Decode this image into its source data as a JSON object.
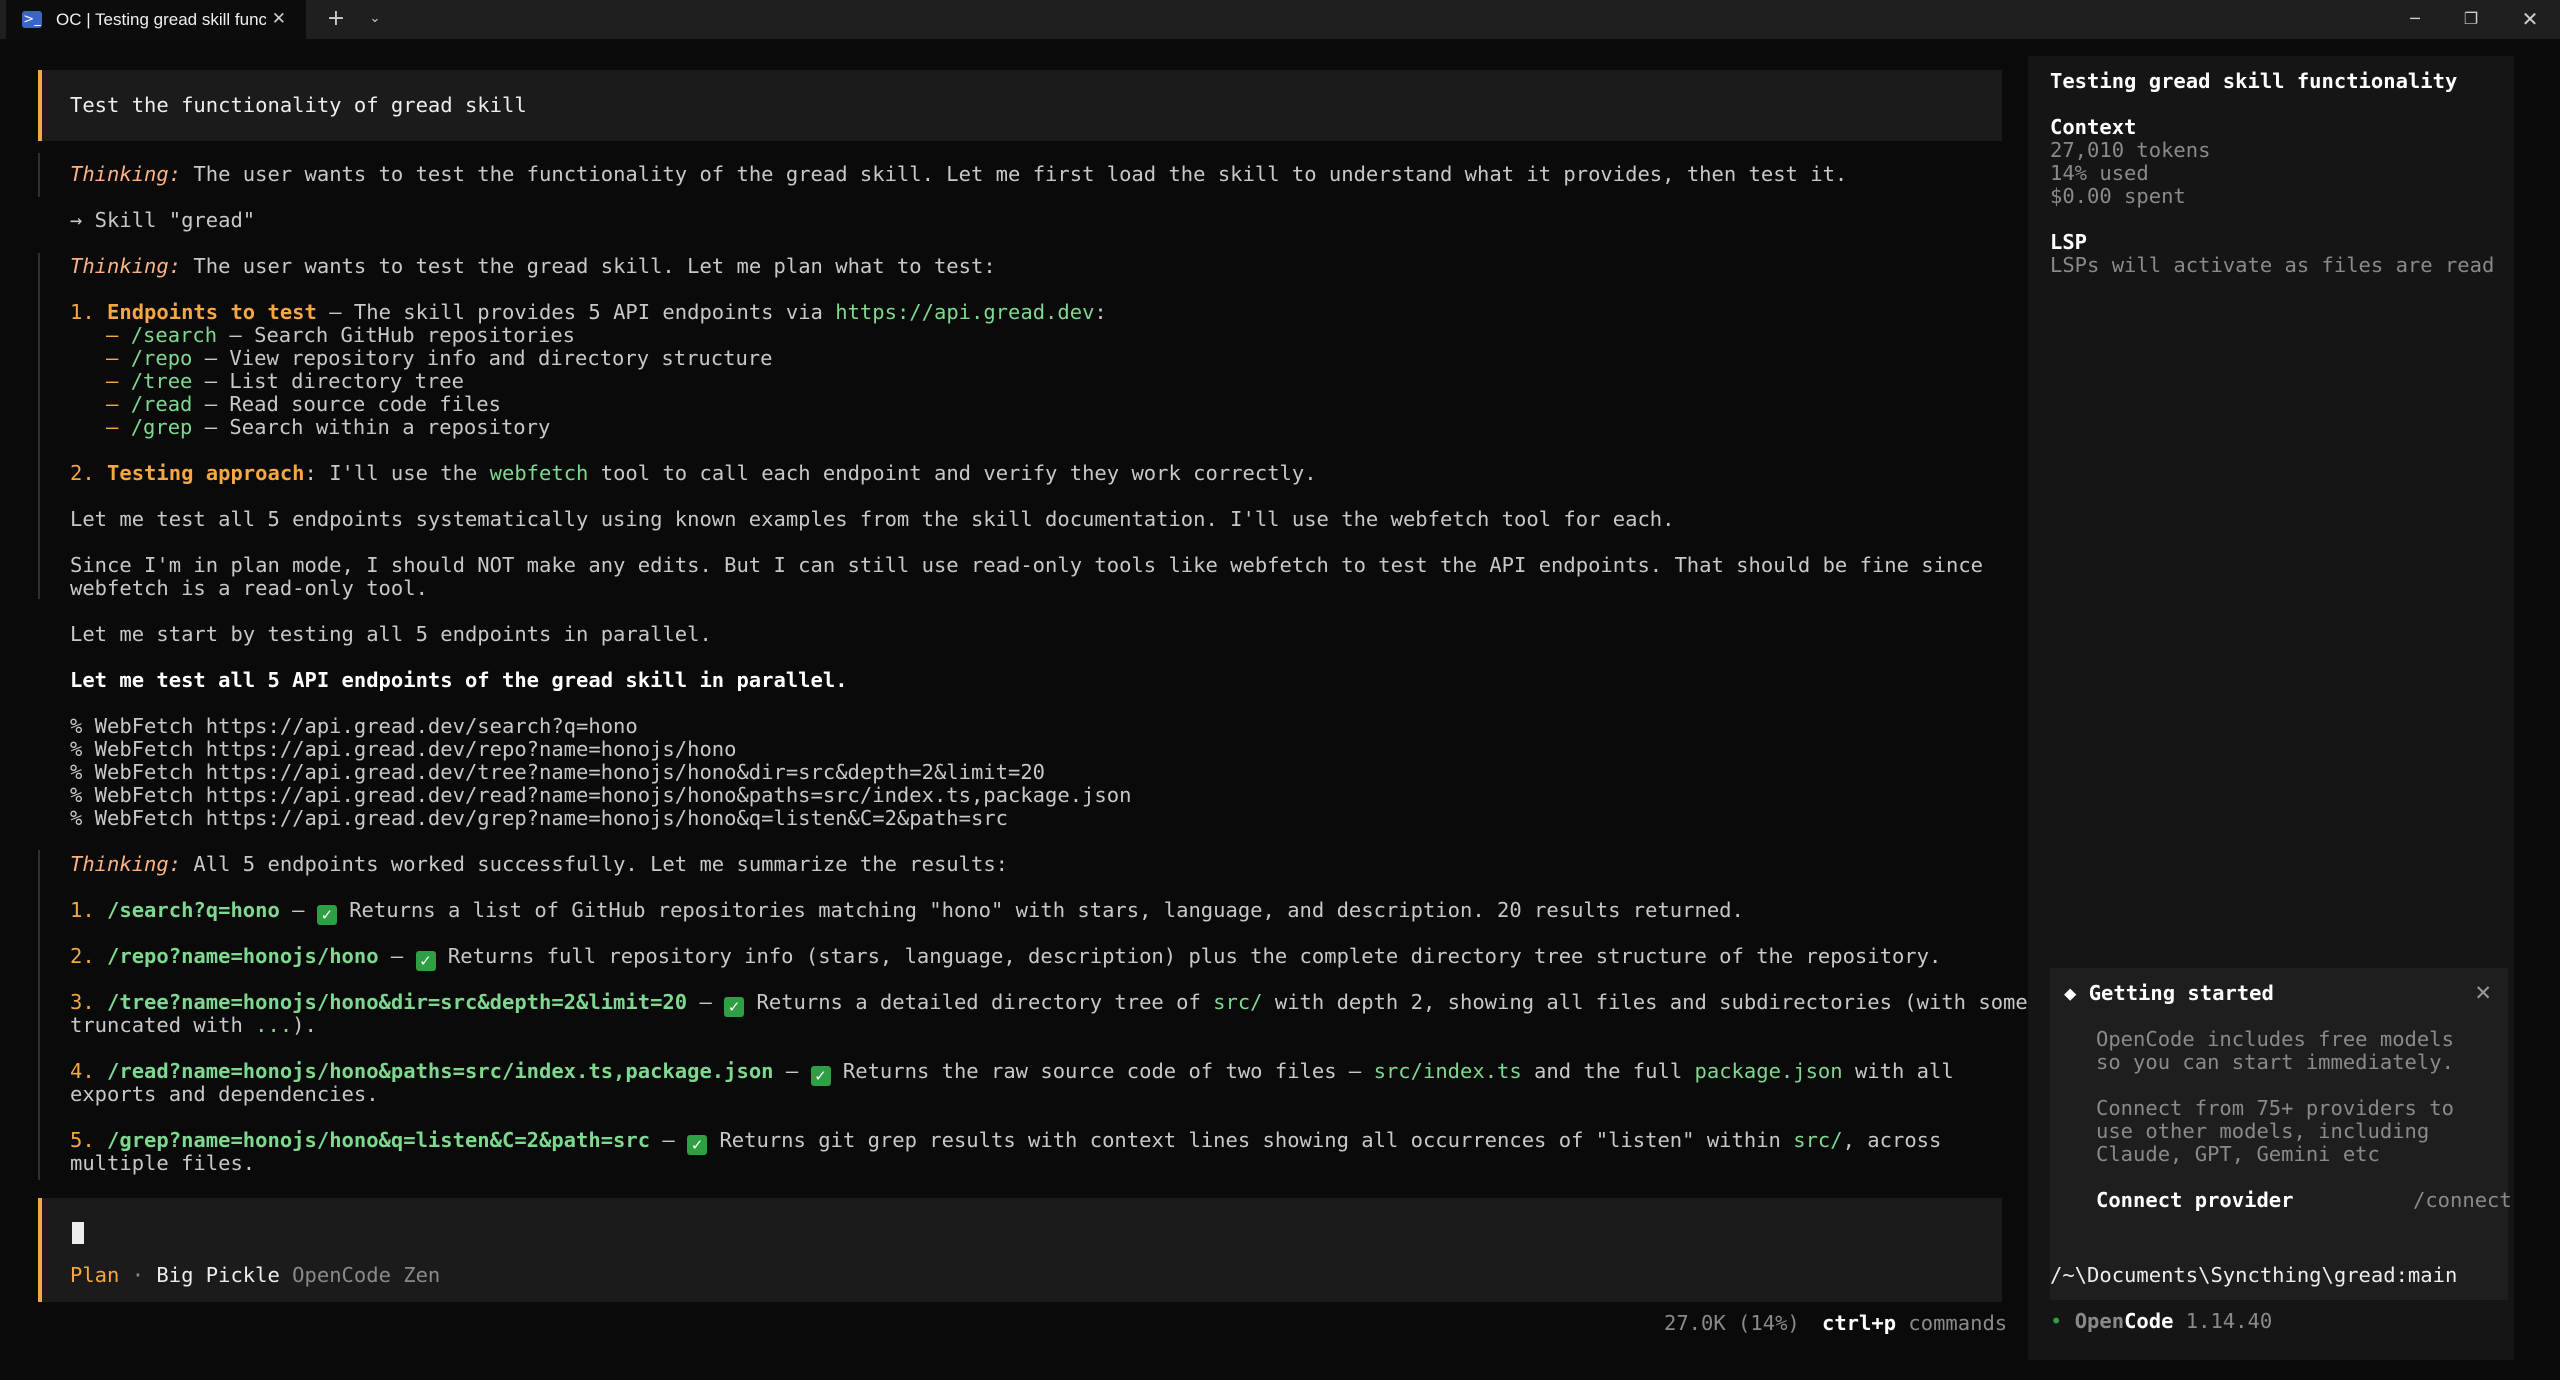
{
  "window": {
    "tab_title": "OC | Testing gread skill functio",
    "tab_icon": "terminal-icon",
    "close_glyph": "✕",
    "new_tab_glyph": "+",
    "dropdown_glyph": "⌄",
    "minimize_glyph": "─",
    "maximize_glyph": "❐",
    "window_close_glyph": "✕"
  },
  "conversation": {
    "user_prompt": "Test the functionality of gread skill",
    "thinking_label": "Thinking:",
    "thinking1": " The user wants to test the functionality of the gread skill. Let me first load the skill to understand what it provides, then test it.",
    "skill_call": "→ Skill \"gread\"",
    "thinking2": " The user wants to test the gread skill. Let me plan what to test:",
    "plan": {
      "item1_num": "1. ",
      "item1_title": "Endpoints to test",
      "item1_text": " – The skill provides 5 API endpoints via ",
      "item1_url": "https://api.gread.dev",
      "item1_colon": ":",
      "bullet": "– ",
      "endpoints": [
        {
          "path": "/search",
          "desc": " – Search GitHub repositories"
        },
        {
          "path": "/repo",
          "desc": " – View repository info and directory structure"
        },
        {
          "path": "/tree",
          "desc": " – List directory tree"
        },
        {
          "path": "/read",
          "desc": " – Read source code files"
        },
        {
          "path": "/grep",
          "desc": " – Search within a repository"
        }
      ],
      "item2_num": "2. ",
      "item2_title": "Testing approach",
      "item2_pre": ": I'll use the ",
      "item2_tool": "webfetch",
      "item2_post": " tool to call each endpoint and verify they work correctly."
    },
    "para1": "Let me test all 5 endpoints systematically using known examples from the skill documentation. I'll use the webfetch tool for each.",
    "para2_line1": "Since I'm in plan mode, I should NOT make any edits. But I can still use read-only tools like webfetch to test the API endpoints. That should be fine since",
    "para2_line2": "webfetch is a read-only tool.",
    "para3": "Let me start by testing all 5 endpoints in parallel.",
    "assistant_msg": "Let me test all 5 API endpoints of the gread skill in parallel.",
    "webfetch_calls": [
      "% WebFetch https://api.gread.dev/search?q=hono",
      "% WebFetch https://api.gread.dev/repo?name=honojs/hono",
      "% WebFetch https://api.gread.dev/tree?name=honojs/hono&dir=src&depth=2&limit=20",
      "% WebFetch https://api.gread.dev/read?name=honojs/hono&paths=src/index.ts,package.json",
      "% WebFetch https://api.gread.dev/grep?name=honojs/hono&q=listen&C=2&path=src"
    ],
    "thinking3": " All 5 endpoints worked successfully. Let me summarize the results:",
    "check_glyph": "✓",
    "results": {
      "r1_num": "1. ",
      "r1_path": "/search?q=hono",
      "r1_text": " Returns a list of GitHub repositories matching \"hono\" with stars, language, and description. 20 results returned.",
      "r2_num": "2. ",
      "r2_path": "/repo?name=honojs/hono",
      "r2_text": " Returns full repository info (stars, language, description) plus the complete directory tree structure of the repository.",
      "r3_num": "3. ",
      "r3_path": "/tree?name=honojs/hono&dir=src&depth=2&limit=20",
      "r3_text": " Returns a detailed directory tree of ",
      "r3_code": "src/",
      "r3_text2": " with depth 2, showing all files and subdirectories (with some",
      "r3_line2_pre": "truncated with ",
      "r3_line2_code": "...",
      "r3_line2_post": ").",
      "r4_num": "4. ",
      "r4_path": "/read?name=honojs/hono&paths=src/index.ts,package.json",
      "r4_text": " Returns the raw source code of two files – ",
      "r4_code1": "src/index.ts",
      "r4_text2": " and the full ",
      "r4_code2": "package.json",
      "r4_text3": " with all",
      "r4_line2": "exports and dependencies.",
      "r5_num": "5. ",
      "r5_path": "/grep?name=honojs/hono&q=listen&C=2&path=src",
      "r5_text": " Returns git grep results with context lines showing all occurrences of \"listen\" within ",
      "r5_code": "src/",
      "r5_text2": ", across",
      "r5_line2": "multiple files."
    },
    "dash": " – "
  },
  "input": {
    "mode": "Plan",
    "separator": " · ",
    "model": "Big Pickle",
    "provider": " OpenCode Zen"
  },
  "status": {
    "tokens": "27.0K (14%)",
    "shortcut_key": "ctrl+p",
    "shortcut_label": " commands"
  },
  "sidebar": {
    "title": "Testing gread skill functionality",
    "context_heading": "Context",
    "tokens": "27,010 tokens",
    "used": "14% used",
    "spent": "$0.00 spent",
    "lsp_heading": "LSP",
    "lsp_text": "LSPs will activate as files are read",
    "card": {
      "icon": "◆",
      "title": "Getting started",
      "close_glyph": "✕",
      "p1_line1": "OpenCode includes free models",
      "p1_line2": "so you can start immediately.",
      "p2_line1": "Connect from 75+ providers to",
      "p2_line2": "use other models, including",
      "p2_line3": "Claude, GPT, Gemini etc",
      "connect_label": "Connect provider",
      "connect_cmd": "/connect"
    },
    "path": "/~\\Documents\\Syncthing\\gread:main",
    "version_dot": "•",
    "brand_open": "Open",
    "brand_code": "Code",
    "version": " 1.14.40"
  }
}
